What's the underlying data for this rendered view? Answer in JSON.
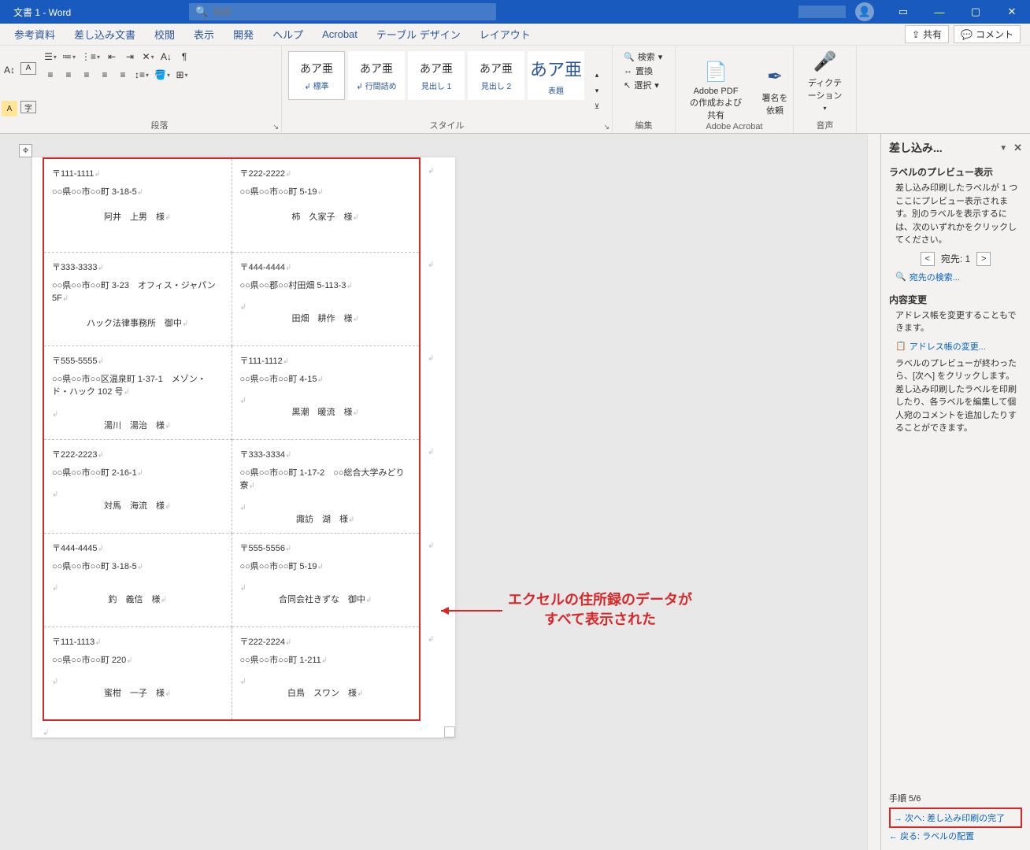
{
  "titlebar": {
    "title": "文書 1  -  Word",
    "search_placeholder": "検索"
  },
  "tabs": {
    "items": [
      "参考資料",
      "差し込み文書",
      "校閲",
      "表示",
      "開発",
      "ヘルプ",
      "Acrobat",
      "テーブル デザイン",
      "レイアウト"
    ],
    "share": "共有",
    "comment": "コメント"
  },
  "ribbon": {
    "paragraph_label": "段落",
    "styles_label": "スタイル",
    "style_items": [
      {
        "preview": "あア亜",
        "name": "↲ 標準"
      },
      {
        "preview": "あア亜",
        "name": "↲ 行間詰め"
      },
      {
        "preview": "あア亜",
        "name": "見出し 1"
      },
      {
        "preview": "あア亜",
        "name": "見出し 2"
      },
      {
        "preview": "あア亜",
        "name": "表題"
      }
    ],
    "edit": {
      "label": "編集",
      "find": "検索",
      "replace": "置換",
      "select": "選択"
    },
    "acrobat": {
      "label": "Adobe Acrobat",
      "pdf": "Adobe PDF の作成および共有",
      "sign": "署名を依頼"
    },
    "voice": {
      "label": "音声",
      "dictate": "ディクテーション"
    }
  },
  "labels": [
    {
      "post": "〒111-1111",
      "addr": "○○県○○市○○町 3-18-5",
      "name": "阿井　上男　様"
    },
    {
      "post": "〒222-2222",
      "addr": "○○県○○市○○町 5-19",
      "name": "柿　久家子　様"
    },
    {
      "post": "〒333-3333",
      "addr": "○○県○○市○○町 3-23　オフィス・ジャパン5F",
      "name": "ハック法律事務所　御中"
    },
    {
      "post": "〒444-4444",
      "addr": "○○県○○郡○○村田畑 5-113-3",
      "name": "田畑　耕作　様"
    },
    {
      "post": "〒555-5555",
      "addr": "○○県○○市○○区温泉町 1-37-1　メゾン・ド・ハック 102 号",
      "name": "湯川　湯治　様"
    },
    {
      "post": "〒111-1112",
      "addr": "○○県○○市○○町 4-15",
      "name": "黒潮　暖流　様"
    },
    {
      "post": "〒222-2223",
      "addr": "○○県○○市○○町 2-16-1",
      "name": "対馬　海流　様"
    },
    {
      "post": "〒333-3334",
      "addr": "○○県○○市○○町 1-17-2　○○総合大学みどり寮",
      "name": "諏訪　湖　様"
    },
    {
      "post": "〒444-4445",
      "addr": "○○県○○市○○町 3-18-5",
      "name": "釣　義信　様"
    },
    {
      "post": "〒555-5556",
      "addr": "○○県○○市○○町 5-19",
      "name": "合同会社きずな　御中"
    },
    {
      "post": "〒111-1113",
      "addr": "○○県○○市○○町 220",
      "name": "蜜柑　一子　様"
    },
    {
      "post": "〒222-2224",
      "addr": "○○県○○市○○町 1-211",
      "name": "白鳥　スワン　様"
    }
  ],
  "annotation": {
    "line1": "エクセルの住所録のデータが",
    "line2": "すべて表示された"
  },
  "pane": {
    "title": "差し込み...",
    "preview_title": "ラベルのプレビュー表示",
    "preview_body": "差し込み印刷したラベルが 1 つここにプレビュー表示されます。別のラベルを表示するには、次のいずれかをクリックしてください。",
    "recipient_label": "宛先: 1",
    "find_recipient": "宛先の検索...",
    "edit_title": "内容変更",
    "edit_body": "アドレス帳を変更することもできます。",
    "edit_link": "アドレス帳の変更...",
    "next_body": "ラベルのプレビューが終わったら、[次へ] をクリックします。差し込み印刷したラベルを印刷したり、各ラベルを編集して個人宛のコメントを追加したりすることができます。",
    "step": "手順 5/6",
    "next": "次へ: 差し込み印刷の完了",
    "back": "戻る: ラベルの配置"
  }
}
